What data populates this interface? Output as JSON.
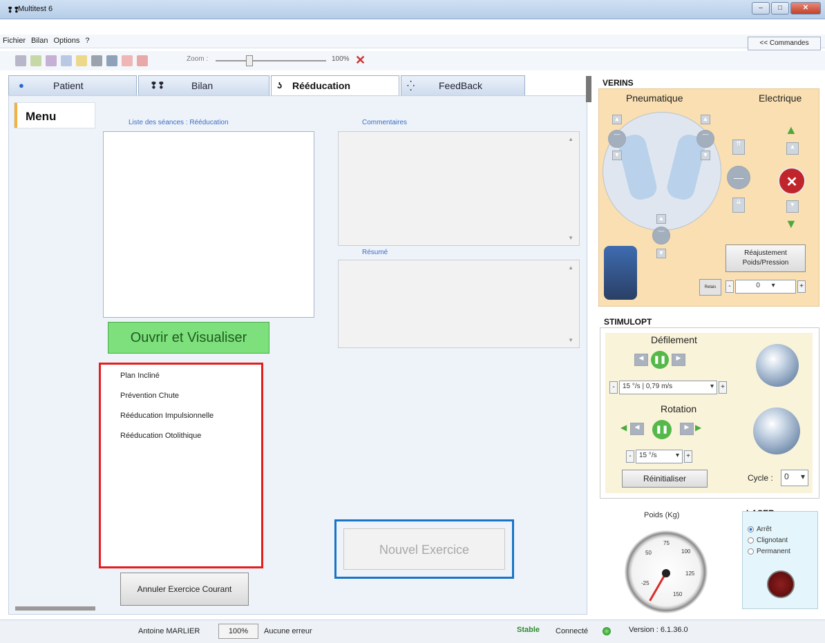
{
  "window": {
    "title": "Multitest 6",
    "logo": "❢❢"
  },
  "menu": {
    "items": [
      "Fichier",
      "Bilan",
      "Options",
      "?"
    ]
  },
  "commandes_label": "<< Commandes",
  "toolbar": {
    "zoom_label": "Zoom :",
    "zoom_value": "100%"
  },
  "tabs": [
    {
      "label": "Patient",
      "icon": "person-icon",
      "active": false
    },
    {
      "label": "Bilan",
      "icon": "feet-icon",
      "active": false
    },
    {
      "label": "Rééducation",
      "icon": "walking-icon",
      "active": true
    },
    {
      "label": "FeedBack",
      "icon": "dots-icon",
      "active": false
    }
  ],
  "sidebar": {
    "title": "Menu"
  },
  "seances": {
    "label": "Liste des séances :  Rééducation"
  },
  "commentaires": {
    "label": "Commentaires"
  },
  "resume": {
    "label": "Résumé"
  },
  "ouvrir_button": "Ouvrir et Visualiser",
  "exercises": [
    "Plan Incliné",
    "Prévention Chute",
    "Rééducation Impulsionnelle",
    "Rééducation Otolithique"
  ],
  "annuler_button": "Annuler Exercice Courant",
  "nouvel_button": "Nouvel Exercice",
  "verins": {
    "title": "VERINS",
    "pneumatique": "Pneumatique",
    "electrique": "Electrique",
    "reajust_line1": "Réajustement",
    "reajust_line2": "Poids/Pression",
    "relais": "Relais",
    "value": "0",
    "minus": "-",
    "plus": "+"
  },
  "stimulopt": {
    "title": "STIMULOPT",
    "defilement": "Défilement",
    "def_speed": "15 °/s  |  0,79 m/s",
    "rotation": "Rotation",
    "rot_speed": "15 °/s",
    "reinit": "Réinitialiser",
    "cycle_label": "Cycle :",
    "cycle_value": "0",
    "minus": "-",
    "plus": "+"
  },
  "poids": {
    "label": "Poids (Kg)",
    "ticks": [
      "-25",
      "50",
      "75",
      "100",
      "125",
      "150"
    ]
  },
  "laser": {
    "title": "LASER",
    "options": [
      {
        "label": "Arrêt",
        "selected": true
      },
      {
        "label": "Clignotant",
        "selected": false
      },
      {
        "label": "Permanent",
        "selected": false
      }
    ]
  },
  "status": {
    "user": "Antoine MARLIER",
    "percent": "100%",
    "error": "Aucune erreur",
    "stable": "Stable",
    "connected": "Connecté",
    "version": "Version : 6.1.36.0"
  },
  "colors": {
    "accent_green": "#7de07c",
    "highlight_red": "#e51d1d",
    "highlight_blue": "#1874c8",
    "verins_bg": "#f9dfb1"
  }
}
